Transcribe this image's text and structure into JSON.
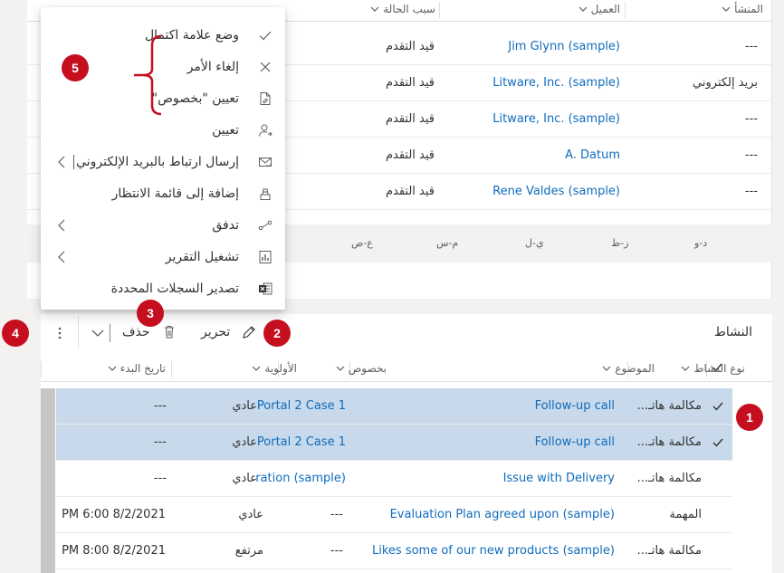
{
  "top_grid": {
    "headers": {
      "origin": "المنشأ",
      "customer": "العميل",
      "status_reason": "سبب الحالة"
    },
    "rows": [
      {
        "origin": "---",
        "customer": "Jim Glynn (sample)",
        "status": "قيد التقدم"
      },
      {
        "origin": "بريد إلكتروني",
        "customer": "Litware, Inc. (sample)",
        "status": "قيد التقدم"
      },
      {
        "origin": "---",
        "customer": "Litware, Inc. (sample)",
        "status": "قيد التقدم"
      },
      {
        "origin": "---",
        "customer": "A. Datum",
        "status": "قيد التقدم"
      },
      {
        "origin": "---",
        "customer": "Rene Valdes (sample)",
        "status": "قيد التقدم"
      }
    ],
    "alphabet": [
      "د-و",
      "ز-ط",
      "ي-ل",
      "م-س",
      "ع-ص"
    ]
  },
  "menu": {
    "items": [
      {
        "label": "وضع علامة اكتمال",
        "icon": "checkmark-icon"
      },
      {
        "label": "إلغاء الأمر",
        "icon": "close-icon"
      },
      {
        "label": "تعيين \"بخصوص\"",
        "icon": "set-regarding-icon"
      },
      {
        "label": "تعيين",
        "icon": "assign-user-icon"
      },
      {
        "label": "إرسال ارتباط بالبريد الإلكتروني",
        "icon": "email-link-icon"
      },
      {
        "label": "إضافة إلى قائمة الانتظار",
        "icon": "add-queue-icon"
      },
      {
        "label": "تدفق",
        "icon": "flow-icon"
      },
      {
        "label": "تشغيل التقرير",
        "icon": "report-icon"
      },
      {
        "label": "تصدير السجلات المحددة",
        "icon": "excel-icon"
      }
    ]
  },
  "badges": {
    "b1": "1",
    "b2": "2",
    "b3": "3",
    "b4": "4",
    "b5": "5"
  },
  "activity": {
    "title": "النشاط",
    "edit_label": "تحرير",
    "delete_label": "حذف",
    "headers": {
      "activity_type": "نوع النشاط",
      "subject": "الموضوع",
      "regarding": "بخصوص",
      "priority": "الأولوية",
      "start_date": "تاريخ البدء"
    },
    "rows": [
      {
        "type": "مكالمة هاتـ...",
        "subject": "Follow-up call",
        "regarding": "Portal 2 Case 1",
        "priority": "عادي",
        "start": "---",
        "selected": true
      },
      {
        "type": "مكالمة هاتـ...",
        "subject": "Follow-up call",
        "regarding": "Portal 2 Case 1",
        "priority": "عادي",
        "start": "---",
        "selected": true
      },
      {
        "type": "مكالمة هاتـ...",
        "subject": "Issue with Delivery",
        "regarding": "ration (sample)",
        "priority": "عادي",
        "start": "---",
        "selected": false
      },
      {
        "type": "المهمة",
        "subject": "Evaluation Plan agreed upon (sample)",
        "regarding": "---",
        "priority": "عادي",
        "start": "8/2/2021 6:00 PM",
        "selected": false
      },
      {
        "type": "مكالمة هاتـ...",
        "subject": "Likes some of our new products (sample)",
        "regarding": "---",
        "priority": "مرتفع",
        "start": "8/2/2021 8:00 PM",
        "selected": false
      }
    ]
  },
  "colors": {
    "accent": "#0f6cbd",
    "badge": "#c50f1f",
    "selected_row": "#c7d9eb"
  }
}
